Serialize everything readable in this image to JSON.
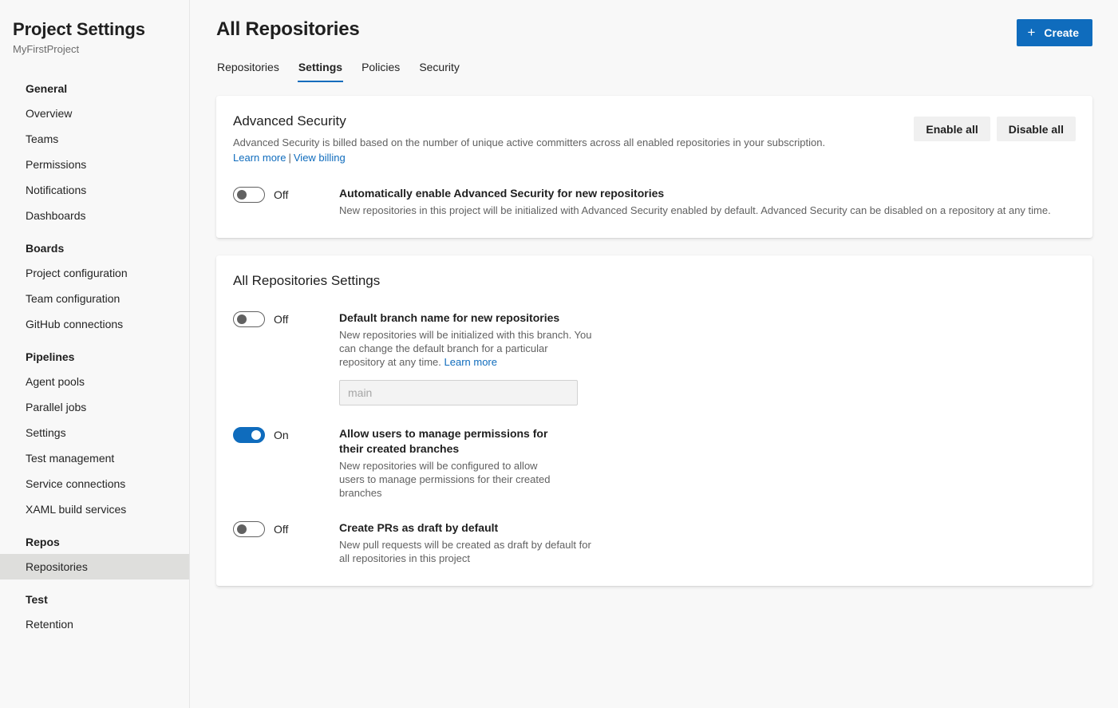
{
  "sidebar": {
    "title": "Project Settings",
    "subtitle": "MyFirstProject",
    "groups": [
      {
        "title": "General",
        "items": [
          {
            "label": "Overview",
            "selected": false
          },
          {
            "label": "Teams",
            "selected": false
          },
          {
            "label": "Permissions",
            "selected": false
          },
          {
            "label": "Notifications",
            "selected": false
          },
          {
            "label": "Dashboards",
            "selected": false
          }
        ]
      },
      {
        "title": "Boards",
        "items": [
          {
            "label": "Project configuration",
            "selected": false
          },
          {
            "label": "Team configuration",
            "selected": false
          },
          {
            "label": "GitHub connections",
            "selected": false
          }
        ]
      },
      {
        "title": "Pipelines",
        "items": [
          {
            "label": "Agent pools",
            "selected": false
          },
          {
            "label": "Parallel jobs",
            "selected": false
          },
          {
            "label": "Settings",
            "selected": false
          },
          {
            "label": "Test management",
            "selected": false
          },
          {
            "label": "Service connections",
            "selected": false
          },
          {
            "label": "XAML build services",
            "selected": false
          }
        ]
      },
      {
        "title": "Repos",
        "items": [
          {
            "label": "Repositories",
            "selected": true
          }
        ]
      },
      {
        "title": "Test",
        "items": [
          {
            "label": "Retention",
            "selected": false
          }
        ]
      }
    ]
  },
  "header": {
    "page_title": "All Repositories",
    "create_button": {
      "label": "Create",
      "icon": "plus-icon"
    },
    "tabs": [
      {
        "label": "Repositories",
        "active": false
      },
      {
        "label": "Settings",
        "active": true
      },
      {
        "label": "Policies",
        "active": false
      },
      {
        "label": "Security",
        "active": false
      }
    ]
  },
  "advanced_security": {
    "title": "Advanced Security",
    "description": "Advanced Security is billed based on the number of unique active committers across all enabled repositories in your subscription.",
    "links": {
      "learn_more": "Learn more",
      "separator": "|",
      "view_billing": "View billing"
    },
    "buttons": {
      "enable_all": "Enable all",
      "disable_all": "Disable all"
    },
    "setting": {
      "state": "Off",
      "on": false,
      "label": "Automatically enable Advanced Security for new repositories",
      "description": "New repositories in this project will be initialized with Advanced Security enabled by default. Advanced Security can be disabled on a repository at any time."
    }
  },
  "all_repositories_settings": {
    "title": "All Repositories Settings",
    "settings": [
      {
        "state": "Off",
        "on": false,
        "label": "Default branch name for new repositories",
        "description": "New repositories will be initialized with this branch. You can change the default branch for a particular repository at any time. ",
        "link": "Learn more",
        "input": {
          "value": "",
          "placeholder": "main"
        }
      },
      {
        "state": "On",
        "on": true,
        "label": "Allow users to manage permissions for their created branches",
        "description": "New repositories will be configured to allow users to manage permissions for their created branches"
      },
      {
        "state": "Off",
        "on": false,
        "label": "Create PRs as draft by default",
        "description": "New pull requests will be created as draft by default for all repositories in this project"
      }
    ]
  },
  "colors": {
    "accent": "#0f6cbd",
    "page_bg": "#f8f8f8",
    "card_bg": "#ffffff",
    "selected_nav": "#dededc"
  }
}
